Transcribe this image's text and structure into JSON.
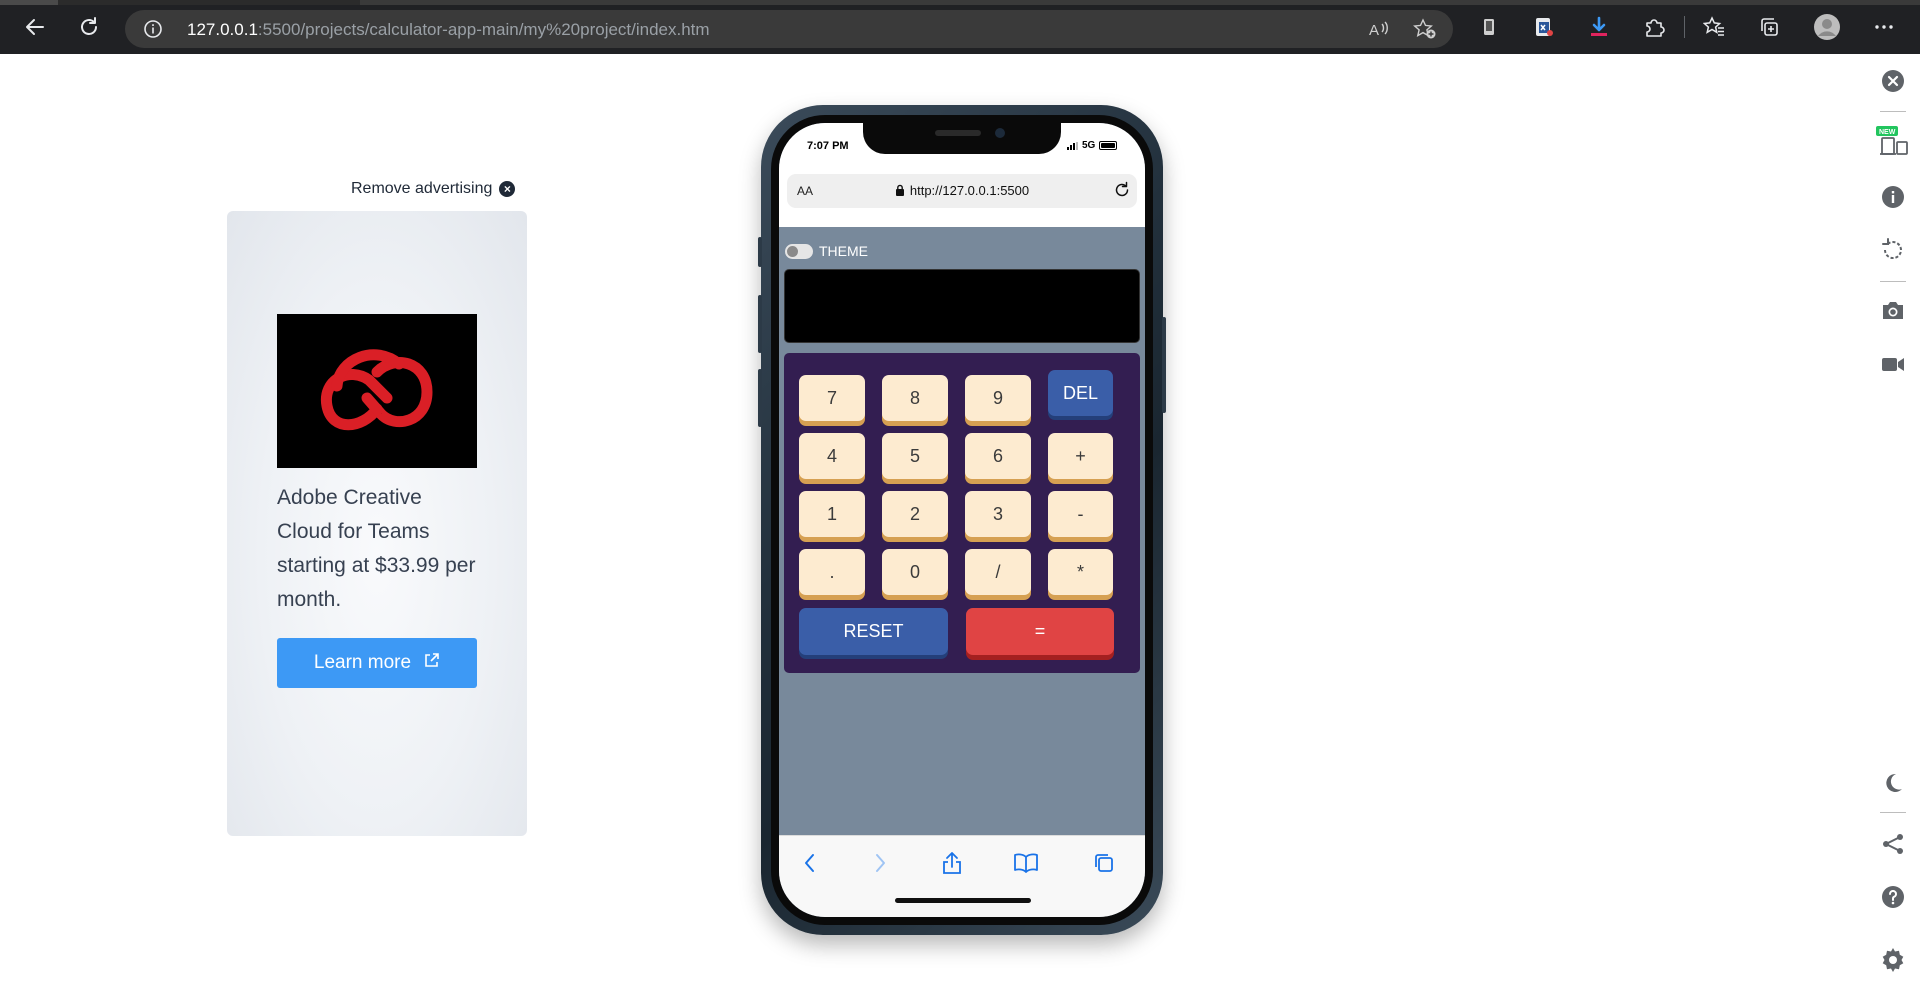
{
  "browser": {
    "url_host": "127.0.0.1",
    "url_rest": ":5500/projects/calculator-app-main/my%20project/index.htm",
    "nav_icons": [
      "back-arrow-icon",
      "refresh-icon",
      "site-info-icon"
    ],
    "toolbar_icons": [
      "read-aloud-icon",
      "add-favorite-icon",
      "app-icon",
      "office-icon",
      "download-icon",
      "extensions-icon",
      "favorites-icon",
      "collections-icon",
      "profile-icon",
      "more-icon"
    ]
  },
  "ad": {
    "remove_label": "Remove advertising",
    "text": "Adobe Creative Cloud for Teams starting at $33.99 per month.",
    "button_label": "Learn more",
    "logo_color": "#da1f26"
  },
  "phone": {
    "time": "7:07 PM",
    "network": "5G",
    "aa": "AA",
    "url": "http://127.0.0.1:5500",
    "theme_label": "THEME",
    "display_value": "",
    "keys": [
      {
        "label": "7"
      },
      {
        "label": "8"
      },
      {
        "label": "9"
      },
      {
        "label": "DEL"
      },
      {
        "label": "4"
      },
      {
        "label": "5"
      },
      {
        "label": "6"
      },
      {
        "label": "+"
      },
      {
        "label": "1"
      },
      {
        "label": "2"
      },
      {
        "label": "3"
      },
      {
        "label": "-"
      },
      {
        "label": "."
      },
      {
        "label": "0"
      },
      {
        "label": "/"
      },
      {
        "label": "*"
      },
      {
        "label": "RESET"
      },
      {
        "label": "="
      }
    ]
  },
  "sidebar": {
    "badge": "NEW",
    "icons": [
      "close-icon",
      "responsive-devices-icon",
      "info-icon",
      "rotate-icon",
      "camera-icon",
      "video-icon",
      "dark-mode-icon",
      "share-icon",
      "help-icon",
      "settings-icon"
    ]
  },
  "colors": {
    "accent": "#3d99f5",
    "keypad_bg": "#331e51",
    "screen_bg": "#78899b",
    "key_bg": "#fdebd0",
    "del_reset": "#3a5ea8",
    "equals": "#e04444"
  }
}
